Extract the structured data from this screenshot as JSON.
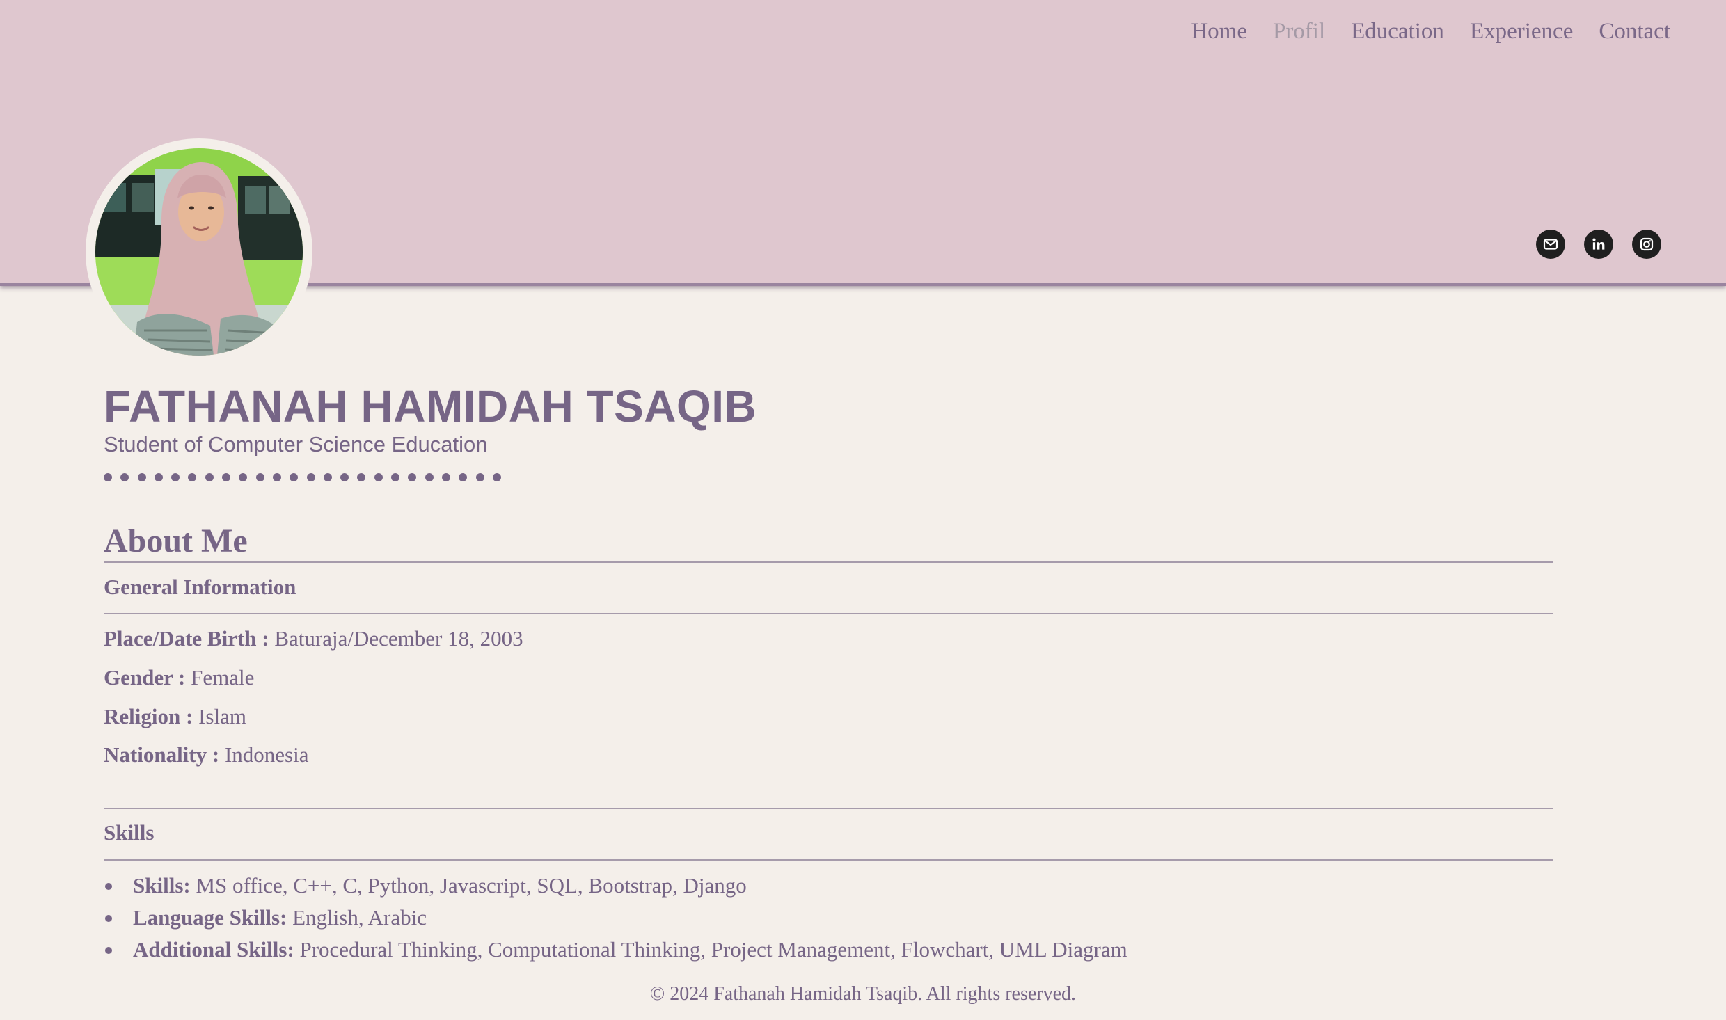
{
  "nav": {
    "items": [
      "Home",
      "Profil",
      "Education",
      "Experience",
      "Contact"
    ],
    "active": "Profil"
  },
  "social": [
    "mail-icon",
    "linkedin-icon",
    "instagram-icon"
  ],
  "profile": {
    "name": "FATHANAH HAMIDAH TSAQIB",
    "subtitle": "Student of Computer Science Education"
  },
  "about": {
    "title": "About Me",
    "general": {
      "heading": "General Information",
      "rows": [
        {
          "label": "Place/Date Birth :",
          "value": "Baturaja/December 18, 2003"
        },
        {
          "label": "Gender :",
          "value": "Female"
        },
        {
          "label": "Religion :",
          "value": "Islam"
        },
        {
          "label": "Nationality :",
          "value": "Indonesia"
        }
      ]
    },
    "skills": {
      "heading": "Skills",
      "items": [
        {
          "label": "Skills:",
          "value": "MS office, C++, C, Python, Javascript, SQL, Bootstrap, Django"
        },
        {
          "label": "Language Skills:",
          "value": "English, Arabic"
        },
        {
          "label": "Additional Skills:",
          "value": "Procedural Thinking, Computational Thinking, Project Management, Flowchart, UML Diagram"
        }
      ]
    }
  },
  "footer": "© 2024 Fathanah Hamidah Tsaqib. All rights reserved.",
  "colors": {
    "header_bg": "#dfc7cf",
    "page_bg": "#f4efea",
    "text": "#766586",
    "nav_active": "#a59aa6"
  }
}
